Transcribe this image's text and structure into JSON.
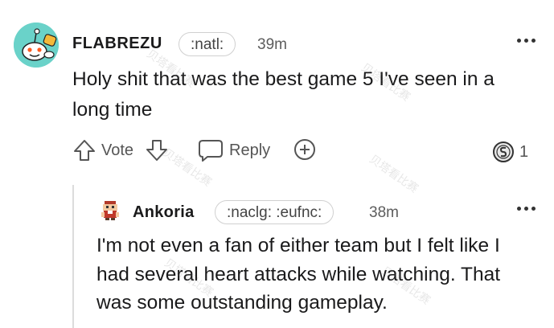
{
  "comment": {
    "username": "FLABREZU",
    "flair": ":natl:",
    "time": "39m",
    "text_line1": "Holy shit that was the best game 5 I've seen in a",
    "text_line2": "long time",
    "actions": {
      "vote_label": "Vote",
      "reply_label": "Reply",
      "award_count": "1"
    }
  },
  "reply": {
    "username": "Ankoria",
    "flair": ":naclg: :eufnc:",
    "time": "38m",
    "text_line1": "I'm not even a fan of either team but I felt like I",
    "text_line2": "had several heart attacks while watching. That",
    "text_line3": "was some outstanding gameplay."
  },
  "watermark": "贝塔看比赛",
  "icons": {
    "upvote": "upvote-arrow-icon",
    "downvote": "downvote-arrow-icon",
    "reply": "speech-bubble-icon",
    "add_award": "plus-circle-icon",
    "award": "coin-award-icon",
    "more": "more-options-icon"
  }
}
